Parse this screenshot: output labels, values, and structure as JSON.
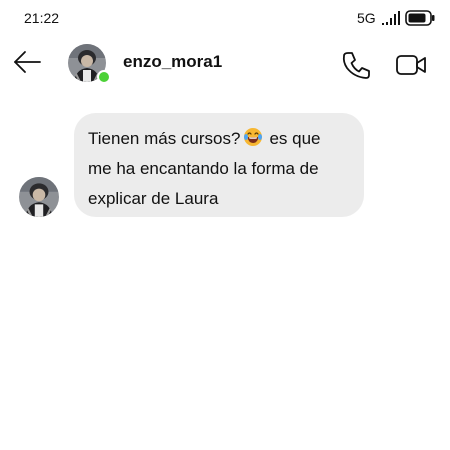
{
  "status_bar": {
    "time": "21:22",
    "network": "5G",
    "signal_icon": "signal-bars-icon",
    "battery_icon": "battery-icon"
  },
  "header": {
    "back_icon": "arrow-left-icon",
    "username": "enzo_mora1",
    "online": true,
    "call_icon": "phone-icon",
    "video_icon": "video-camera-icon"
  },
  "messages": [
    {
      "sender": "enzo_mora1",
      "line1_before_emoji": "Tienen más cursos?",
      "emoji": "laughing-tears-emoji",
      "line1_after_emoji": "es que",
      "line2": "me ha encantando la forma de",
      "line3": "explicar de Laura"
    }
  ],
  "colors": {
    "bubble_bg": "#ececec",
    "online_dot": "#4cd137",
    "text": "#111111"
  }
}
